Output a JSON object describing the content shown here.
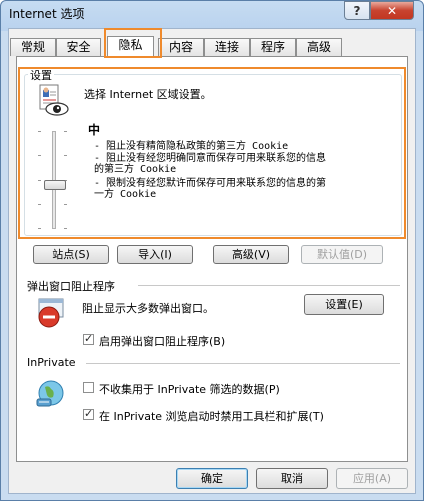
{
  "window": {
    "title": "Internet 选项",
    "help_label": "?",
    "close_label": "✕"
  },
  "tabs": [
    {
      "label": "常规"
    },
    {
      "label": "安全"
    },
    {
      "label": "隐私",
      "active": true
    },
    {
      "label": "内容"
    },
    {
      "label": "连接"
    },
    {
      "label": "程序"
    },
    {
      "label": "高级"
    }
  ],
  "settings": {
    "group_label": "设置",
    "intro": "选择 Internet 区域设置。",
    "level": "中",
    "bullets": [
      "- 阻止没有精简隐私政策的第三方 Cookie",
      "- 阻止没有经您明确同意而保存可用来联系您的信息\n的第三方 Cookie",
      "- 限制没有经您默许而保存可用来联系您的信息的第\n一方 Cookie"
    ],
    "slider_level": 0.55,
    "buttons": {
      "sites": "站点(S)",
      "import": "导入(I)",
      "advanced": "高级(V)",
      "default": "默认值(D)"
    }
  },
  "popup": {
    "group_label": "弹出窗口阻止程序",
    "description": "阻止显示大多数弹出窗口。",
    "settings_button": "设置(E)",
    "enable_label": "启用弹出窗口阻止程序(B)",
    "enable_checked": true
  },
  "inprivate": {
    "group_label": "InPrivate",
    "option1_label": "不收集用于 InPrivate 筛选的数据(P)",
    "option1_checked": false,
    "option2_label": "在 InPrivate 浏览启动时禁用工具栏和扩展(T)",
    "option2_checked": true
  },
  "footer": {
    "ok": "确定",
    "cancel": "取消",
    "apply": "应用(A)"
  },
  "colors": {
    "highlight": "#ef8a2c",
    "title_bg": "#c6dcf2",
    "close": "#c8432f"
  }
}
